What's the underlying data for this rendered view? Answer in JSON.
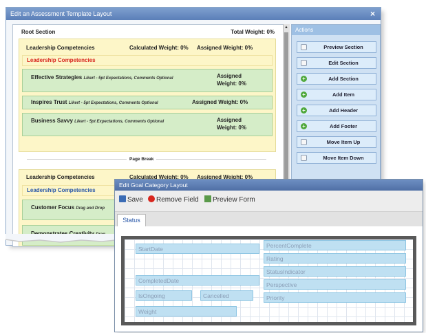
{
  "assessment_window": {
    "title": "Edit an Assessment Template Layout",
    "close": "×",
    "root_section": "Root Section",
    "total_weight": "Total Weight: 0%",
    "section1": {
      "name": "Leadership Competencies",
      "calculated": "Calculated Weight: 0%",
      "assigned": "Assigned Weight: 0%",
      "header": "Leadership Competencies",
      "items": [
        {
          "name": "Effective Strategies",
          "desc": "Likert - 5pt Expectations, Comments Optional",
          "weight_line1": "Assigned",
          "weight_line2": "Weight: 0%"
        },
        {
          "name": "Inspires Trust",
          "desc": "Likert - 5pt Expectations, Comments Optional",
          "weight_line1": "Assigned Weight: 0%",
          "weight_line2": ""
        },
        {
          "name": "Business Savvy",
          "desc": "Likert - 5pt Expectations, Comments Optional",
          "weight_line1": "Assigned",
          "weight_line2": "Weight: 0%"
        }
      ]
    },
    "page_break": "Page Break",
    "section2": {
      "name": "Leadership Competencies",
      "calculated": "Calculated Weight: 0%",
      "assigned": "Assigned Weight: 0%",
      "header": "Leadership Competencies",
      "items": [
        {
          "name": "Customer Focus",
          "desc": "Drag and Drop"
        },
        {
          "name": "Demonstrates Creativity",
          "desc": "Drag"
        }
      ]
    },
    "actions": {
      "title": "Actions",
      "buttons": [
        "Preview Section",
        "Edit Section",
        "Add Section",
        "Add Item",
        "Add Header",
        "Add Footer",
        "Move Item Up",
        "Move Item Down"
      ]
    }
  },
  "goal_window": {
    "title": "Edit Goal Category Layout",
    "toolbar": {
      "save": "Save",
      "remove": "Remove Field",
      "preview": "Preview Form"
    },
    "tab": "Status",
    "fields": [
      "StartDate",
      "PercentComplete",
      "Rating",
      "StatusIndicator",
      "CompletedDate",
      "Perspective",
      "IsOngoing",
      "Cancelled",
      "Priority",
      "Weight"
    ]
  },
  "colors": {
    "title_bar": "#5b7fb8",
    "yellow_section": "#fdf6c8",
    "green_item": "#d5edc8",
    "field": "#bfe0f2",
    "red_header": "#d8261e",
    "blue_header": "#2957a8"
  }
}
